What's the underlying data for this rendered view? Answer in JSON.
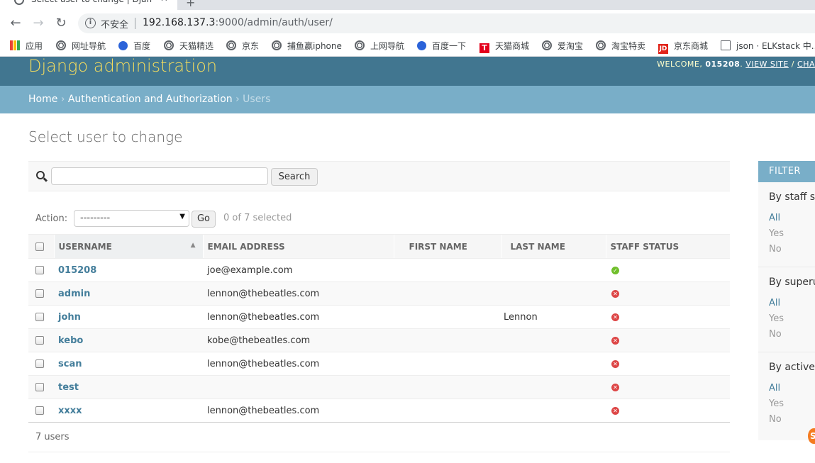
{
  "browser": {
    "tab_title": "Select user to change | Django",
    "url_insecure_label": "不安全",
    "url_host": "192.168.137.3",
    "url_rest": ":9000/admin/auth/user/",
    "bookmarks": [
      {
        "label": "应用",
        "icon": "apps-grid-icon"
      },
      {
        "label": "网址导航",
        "icon": "globe-icon"
      },
      {
        "label": "百度",
        "icon": "baidu-paw-icon"
      },
      {
        "label": "天猫精选",
        "icon": "globe-icon"
      },
      {
        "label": "京东",
        "icon": "globe-icon"
      },
      {
        "label": "捕鱼赢iphone",
        "icon": "globe-icon"
      },
      {
        "label": "上网导航",
        "icon": "globe-icon"
      },
      {
        "label": "百度一下",
        "icon": "baidu-paw-icon"
      },
      {
        "label": "天猫商城",
        "icon": "tmall-icon"
      },
      {
        "label": "爱淘宝",
        "icon": "globe-icon"
      },
      {
        "label": "淘宝特卖",
        "icon": "globe-icon"
      },
      {
        "label": "京东商城",
        "icon": "jd-icon"
      },
      {
        "label": "json · ELKstack 中...",
        "icon": "book-icon"
      }
    ]
  },
  "header": {
    "branding": "Django administration",
    "welcome": "WELCOME,",
    "username": "015208",
    "view_site": "VIEW SITE",
    "separator": "/",
    "change_password": "CHA"
  },
  "breadcrumbs": {
    "home": "Home",
    "app": "Authentication and Authorization",
    "current": "Users",
    "sep": "›"
  },
  "page_title": "Select user to change",
  "search": {
    "value": "",
    "button_label": "Search"
  },
  "actions": {
    "label": "Action:",
    "selected_option": "---------",
    "go_label": "Go",
    "selected_count": "0 of 7 selected"
  },
  "table": {
    "columns": [
      "USERNAME",
      "EMAIL ADDRESS",
      "FIRST NAME",
      "LAST NAME",
      "STAFF STATUS"
    ],
    "rows": [
      {
        "username": "015208",
        "email": "joe@example.com",
        "first_name": "",
        "last_name": "",
        "staff": true
      },
      {
        "username": "admin",
        "email": "lennon@thebeatles.com",
        "first_name": "",
        "last_name": "",
        "staff": false
      },
      {
        "username": "john",
        "email": "lennon@thebeatles.com",
        "first_name": "",
        "last_name": "Lennon",
        "staff": false
      },
      {
        "username": "kebo",
        "email": "kobe@thebeatles.com",
        "first_name": "",
        "last_name": "",
        "staff": false
      },
      {
        "username": "scan",
        "email": "lennon@thebeatles.com",
        "first_name": "",
        "last_name": "",
        "staff": false
      },
      {
        "username": "test",
        "email": "",
        "first_name": "",
        "last_name": "",
        "staff": false
      },
      {
        "username": "xxxx",
        "email": "lennon@thebeatles.com",
        "first_name": "",
        "last_name": "",
        "staff": false
      }
    ]
  },
  "paginator": "7 users",
  "filter": {
    "title": "FILTER",
    "groups": [
      {
        "title": "By staff st",
        "options": [
          "All",
          "Yes",
          "No"
        ],
        "selected": 0
      },
      {
        "title": "By superus",
        "options": [
          "All",
          "Yes",
          "No"
        ],
        "selected": 0
      },
      {
        "title": "By active",
        "options": [
          "All",
          "Yes",
          "No"
        ],
        "selected": 0
      }
    ]
  },
  "colors": {
    "header_bg": "#417690",
    "branding": "#f5dd5d",
    "breadcrumbs_bg": "#79aec8",
    "link": "#447e9b",
    "staff_yes": "#70bf2b",
    "staff_no": "#dd4646"
  }
}
